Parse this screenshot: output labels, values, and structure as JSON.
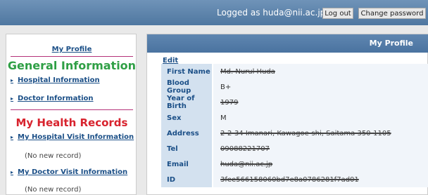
{
  "topbar": {
    "logged_text": "Logged as huda@nii.ac.jp",
    "logout_label": "Log out",
    "change_password_label": "Change password"
  },
  "sidebar": {
    "my_profile": "My Profile",
    "general_heading": "General Information",
    "hospital_info": "Hospital Information",
    "doctor_info": "Doctor Information",
    "health_heading": "My Health Records",
    "hospital_visit": "My Hospital Visit Information",
    "hospital_visit_status": "(No new record)",
    "doctor_visit": "My Doctor Visit Information",
    "doctor_visit_status": "(No new record)"
  },
  "main": {
    "title": "My Profile",
    "edit": "Edit",
    "rows": [
      {
        "label": "First Name",
        "value": "Md. Nurul Huda"
      },
      {
        "label": "Blood Group",
        "value": "B+"
      },
      {
        "label": "Year of Birth",
        "value": "1979"
      },
      {
        "label": "Sex",
        "value": "M"
      },
      {
        "label": "Address",
        "value": "2-2-34 Imanari, Kawagoe-shi, Saitama 350-1105"
      },
      {
        "label": "Tel",
        "value": "09088221707"
      },
      {
        "label": "Email",
        "value": "huda@nii.ac.jp"
      },
      {
        "label": "ID",
        "value": "3fee566158060bd7e8a0786281f7ad01"
      }
    ]
  }
}
